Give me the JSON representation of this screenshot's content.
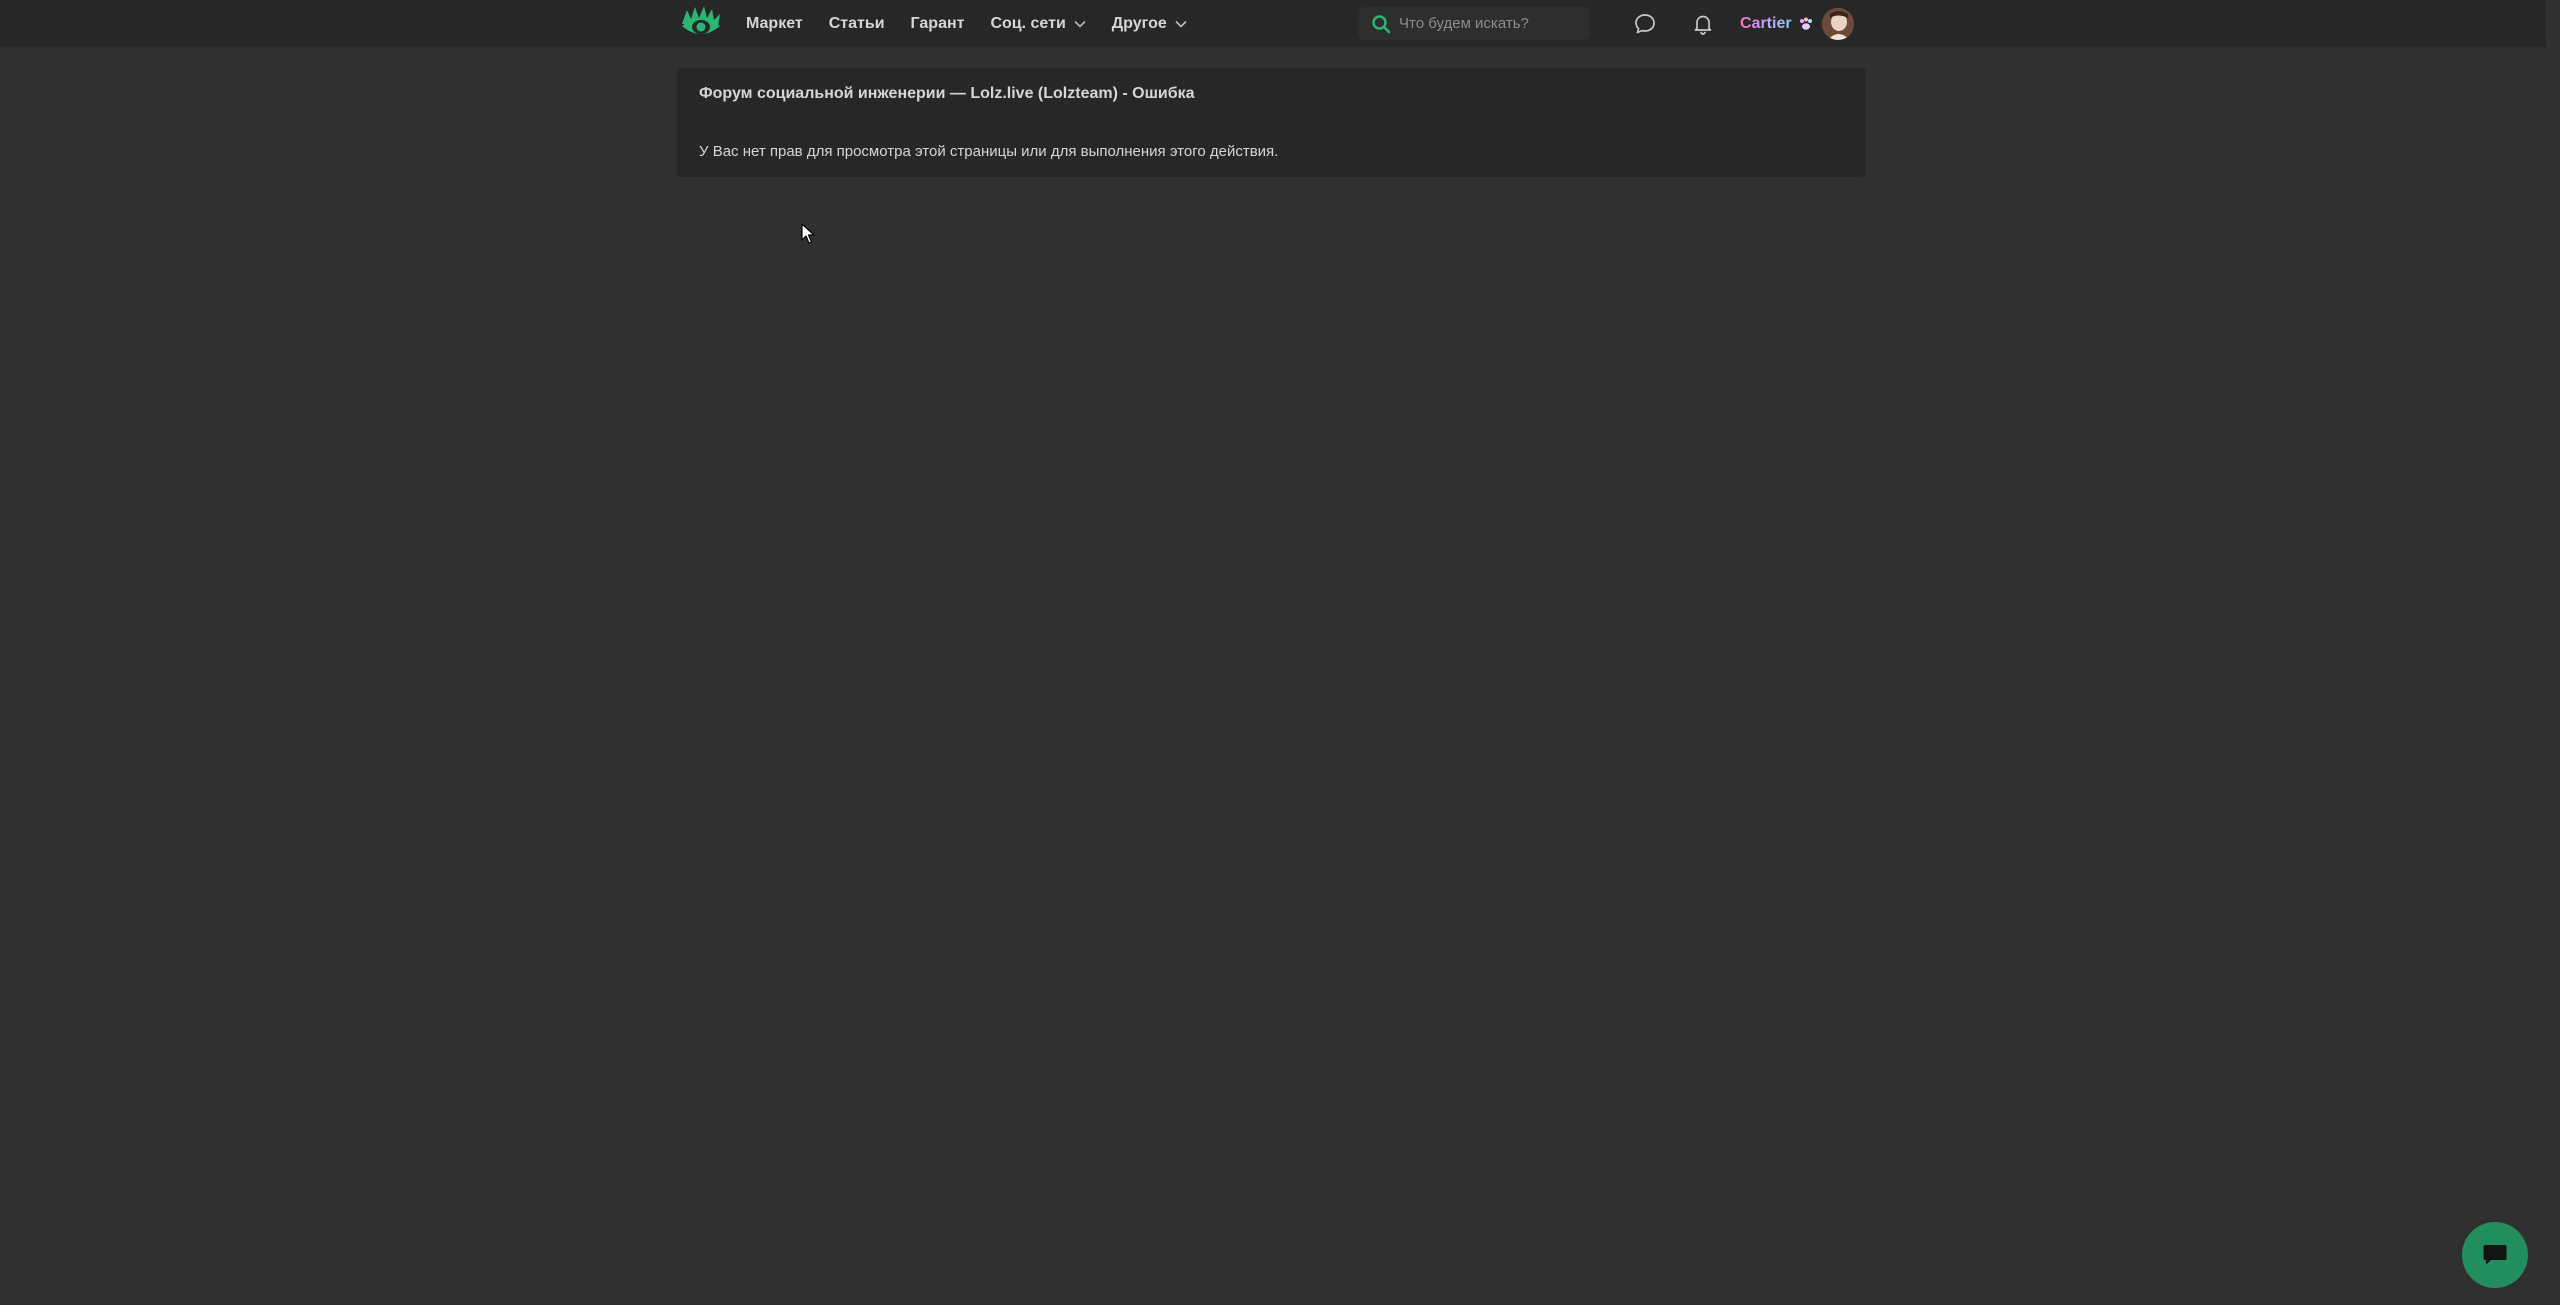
{
  "header": {
    "nav": [
      {
        "label": "Маркет",
        "dropdown": false
      },
      {
        "label": "Статьи",
        "dropdown": false
      },
      {
        "label": "Гарант",
        "dropdown": false
      },
      {
        "label": "Соц. сети",
        "dropdown": true
      },
      {
        "label": "Другое",
        "dropdown": true
      }
    ],
    "search": {
      "placeholder": "Что будем искать?",
      "value": ""
    },
    "icons": [
      "message-icon",
      "bell-icon"
    ],
    "user": {
      "name": "Cartier"
    }
  },
  "main": {
    "error": {
      "title": "Форум социальной инженерии — Lolz.live (Lolzteam) - Ошибка",
      "message": "У Вас нет прав для просмотра этой страницы или для выполнения этого действия."
    }
  },
  "colors": {
    "background": "#303030",
    "header": "#272727",
    "panel": "#272727",
    "accent": "#228e5d",
    "text": "#d6d6d6"
  }
}
